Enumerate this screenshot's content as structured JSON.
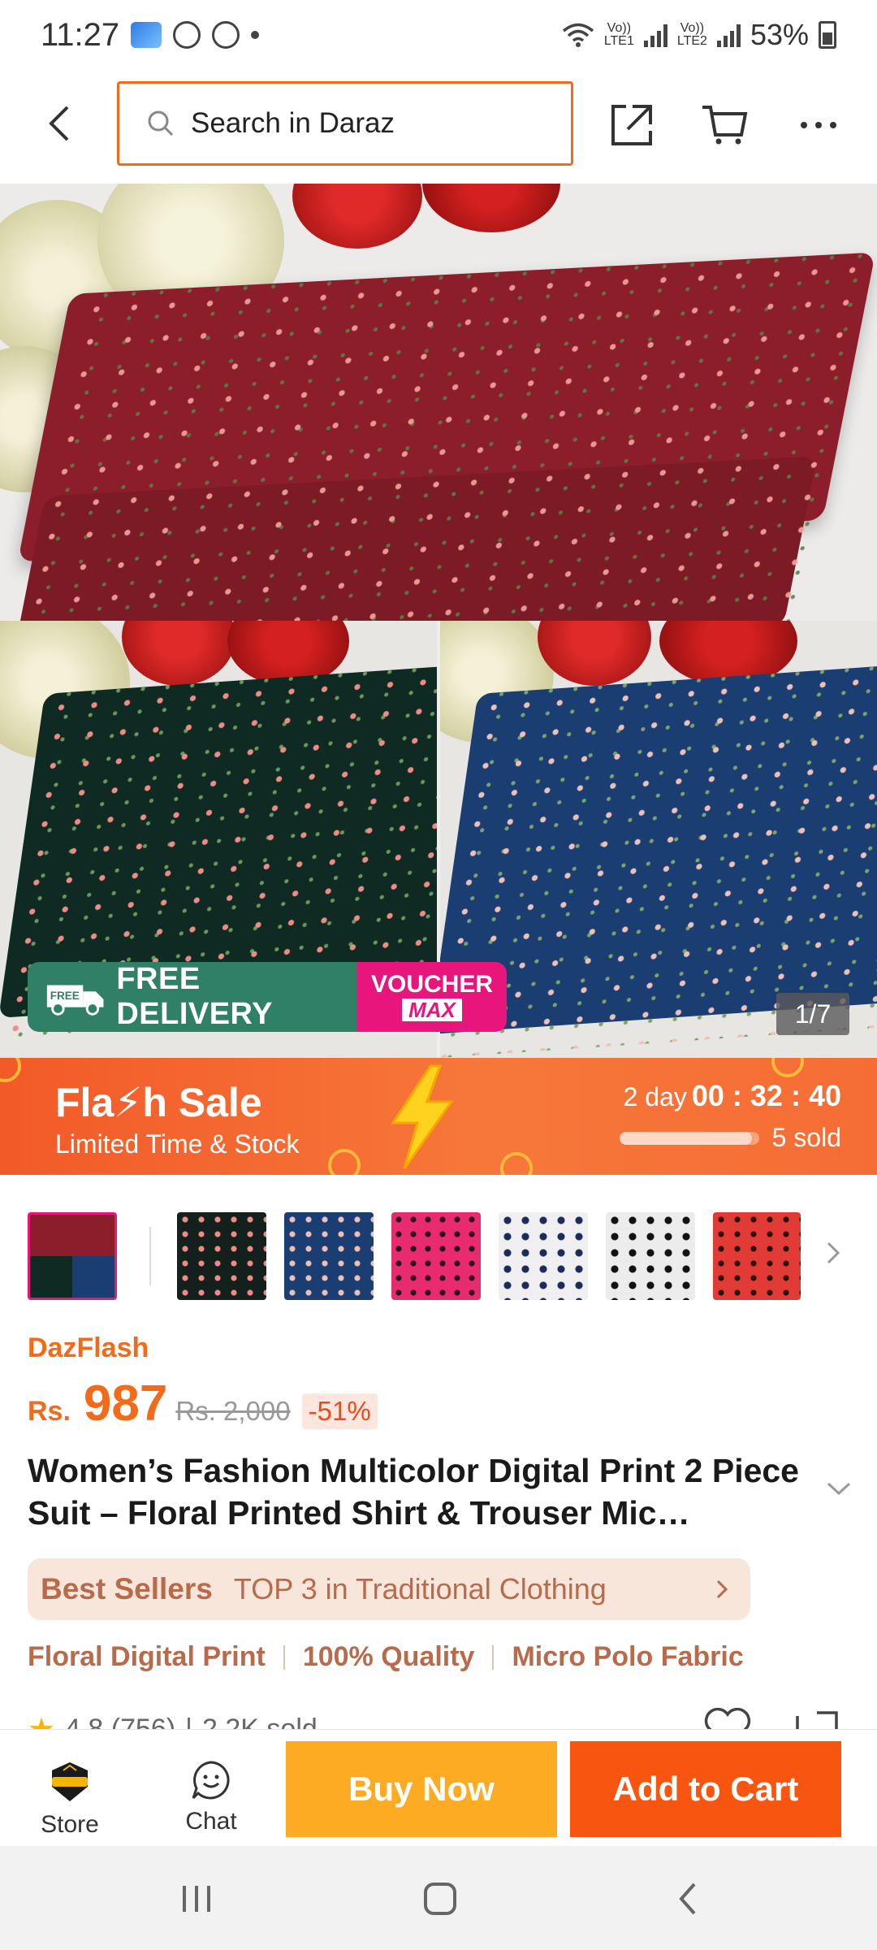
{
  "status_bar": {
    "time": "11:27",
    "sim1": "LTE1",
    "sim2": "LTE2",
    "battery": "53%"
  },
  "header": {
    "search_placeholder": "Search in Daraz"
  },
  "gallery": {
    "promo_free": "FREE",
    "promo_label": "FREE DELIVERY",
    "promo_voucher": "VOUCHER",
    "promo_max": "MAX",
    "counter": "1/7"
  },
  "flash_sale": {
    "title": "Fla⚡h Sale",
    "subtitle": "Limited Time & Stock",
    "day_label": "2 day",
    "timer": "00 : 32 : 40",
    "sold": "5 sold",
    "sold_progress": 0.95
  },
  "thumbnails": [
    {
      "name": "maroon-green-blue",
      "active": true
    },
    {
      "name": "black-floral",
      "active": false
    },
    {
      "name": "blue-floral",
      "active": false
    },
    {
      "name": "pink-polka",
      "active": false
    },
    {
      "name": "white-navy",
      "active": false
    },
    {
      "name": "white-black",
      "active": false
    },
    {
      "name": "red-floral",
      "active": false
    }
  ],
  "product": {
    "brand_label": "DazFlash",
    "currency": "Rs.",
    "price": "987",
    "old_price": "Rs. 2,000",
    "discount": "-51%",
    "title": "Women’s Fashion Multicolor Digital Print 2 Piece Suit – Floral Printed Shirt & Trouser Mic…",
    "best_seller_brand": "Best Sellers",
    "best_seller_text": "TOP 3 in Traditional Clothing",
    "tags": [
      "Floral Digital Print",
      "100% Quality",
      "Micro Polo Fabric"
    ],
    "rating": "4.8 (756)",
    "sold": "2.2K sold"
  },
  "bottom_bar": {
    "store": "Store",
    "chat": "Chat",
    "buy_now": "Buy Now",
    "add_to_cart": "Add to Cart"
  },
  "colors": {
    "accent": "#f36a1b",
    "buy_now": "#fdab22",
    "add_to_cart": "#f85610",
    "promo_green": "#2f8067",
    "promo_pink": "#e8157d"
  }
}
